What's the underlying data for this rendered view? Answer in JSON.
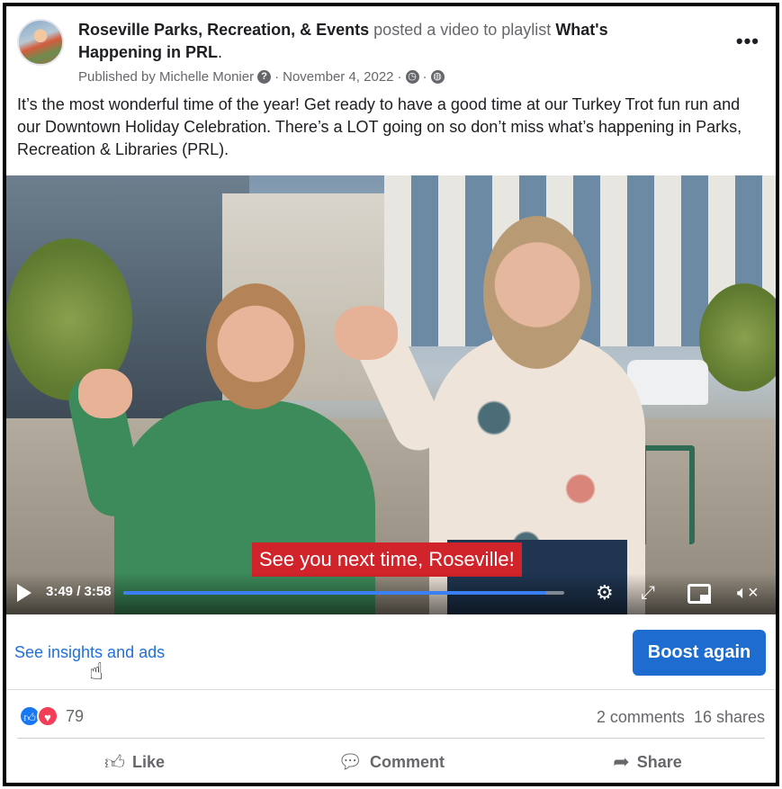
{
  "post": {
    "page_name": "Roseville Parks, Recreation, & Events",
    "action_text": "posted a video to playlist",
    "playlist_name": "What's Happening in PRL",
    "period": ".",
    "published_by": "Published by Michelle Monier",
    "separator": "·",
    "date": "November 4, 2022",
    "more_icon": "more-horizontal-icon",
    "body": "It’s the most wonderful time of the year! Get ready to have a good time at our Turkey Trot fun run and our Downtown Holiday Celebration. There’s a LOT going on so don’t miss what’s happening in Parks, Recreation & Libraries (PRL)."
  },
  "video": {
    "caption": "See you next time, Roseville!",
    "time": "3:49 / 3:58",
    "progress_fraction": 0.96,
    "colors": {
      "progress": "#3b7ff5",
      "caption_bg": "#d1232a"
    }
  },
  "actions": {
    "insights_link": "See insights and ads",
    "boost_label": "Boost again"
  },
  "stats": {
    "reaction_count": "79",
    "comments": "2 comments",
    "shares": "16 shares"
  },
  "buttons": {
    "like": "Like",
    "comment": "Comment",
    "share": "Share"
  },
  "colors": {
    "link": "#216fdb",
    "button": "#1e6ccf",
    "muted_text": "#65676b"
  }
}
